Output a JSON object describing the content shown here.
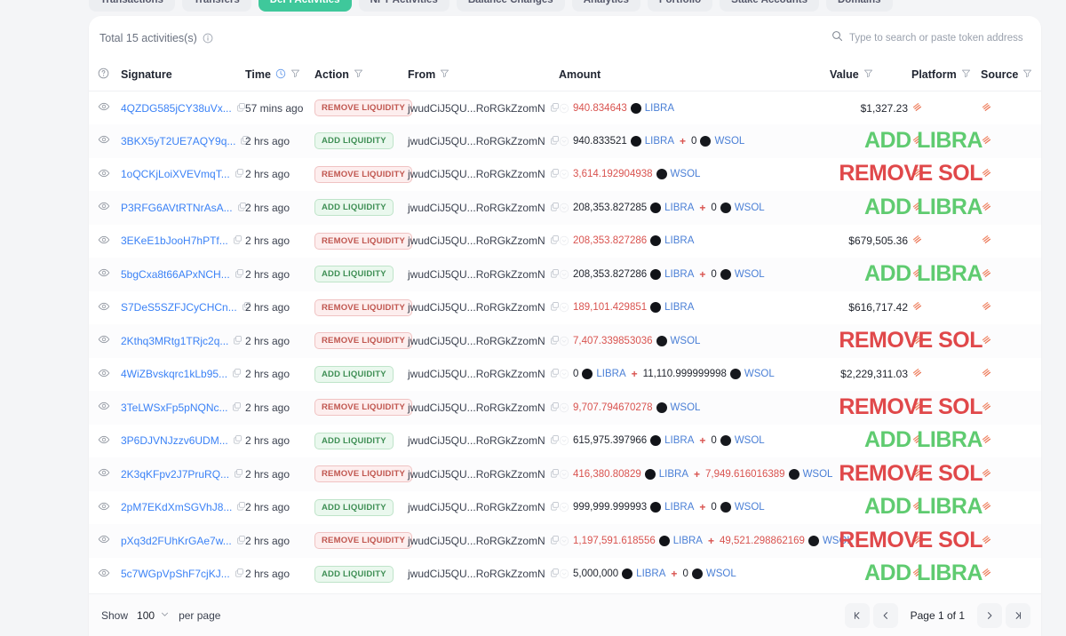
{
  "tabs": [
    {
      "label": "Transactions",
      "active": false
    },
    {
      "label": "Transfers",
      "active": false
    },
    {
      "label": "DeFi Activities",
      "active": true
    },
    {
      "label": "NFT Activities",
      "active": false
    },
    {
      "label": "Balance Changes",
      "active": false
    },
    {
      "label": "Analytics",
      "active": false
    },
    {
      "label": "Portfolio",
      "active": false
    },
    {
      "label": "Stake Accounts",
      "active": false
    },
    {
      "label": "Domains",
      "active": false
    }
  ],
  "header": {
    "total_text": "Total 15 activities(s)",
    "info_icon": "info-circle-icon",
    "search_placeholder": "Type to search or paste token address",
    "search_value": "",
    "search_icon": "search-icon"
  },
  "columns": {
    "eye": "",
    "signature": "Signature",
    "time": "Time",
    "action": "Action",
    "from": "From",
    "amount": "Amount",
    "value": "Value",
    "platform": "Platform",
    "source": "Source"
  },
  "colors": {
    "accent_green": "#3fc89b",
    "add_text": "#5fcb70",
    "remove_text": "#e0484a",
    "link_blue": "#3b82f6",
    "amount_red": "#d9534f",
    "token_blue": "#4a7fd6"
  },
  "rows": [
    {
      "signature": "4QZDG585jCY38uVx...",
      "time": "57 mins ago",
      "action": "REMOVE LIQUIDITY",
      "action_type": "remove",
      "from": "jwudCiJ5QU...RoRGkZzomN",
      "amount": [
        {
          "num": "940.834643",
          "num_color": "red",
          "token": "LIBRA"
        }
      ],
      "value": "$1,327.23",
      "overlay": "",
      "overlay_type": ""
    },
    {
      "signature": "3BKX5yT2UE7AQY9q...",
      "time": "2 hrs ago",
      "action": "ADD LIQUIDITY",
      "action_type": "add",
      "from": "jwudCiJ5QU...RoRGkZzomN",
      "amount": [
        {
          "num": "940.833521",
          "num_color": "black",
          "token": "LIBRA"
        },
        {
          "num": "0",
          "num_color": "black",
          "token": "WSOL"
        }
      ],
      "value": "",
      "overlay": "ADD LIBRA",
      "overlay_type": "green"
    },
    {
      "signature": "1oQCKjLoiXVEVmqT...",
      "time": "2 hrs ago",
      "action": "REMOVE LIQUIDITY",
      "action_type": "remove",
      "from": "jwudCiJ5QU...RoRGkZzomN",
      "amount": [
        {
          "num": "3,614.192904938",
          "num_color": "red",
          "token": "WSOL"
        }
      ],
      "value": "",
      "overlay": "REMOVE SOL",
      "overlay_type": "red"
    },
    {
      "signature": "P3RFG6AVtRTNrAsA...",
      "time": "2 hrs ago",
      "action": "ADD LIQUIDITY",
      "action_type": "add",
      "from": "jwudCiJ5QU...RoRGkZzomN",
      "amount": [
        {
          "num": "208,353.827285",
          "num_color": "black",
          "token": "LIBRA"
        },
        {
          "num": "0",
          "num_color": "black",
          "token": "WSOL"
        }
      ],
      "value": "",
      "overlay": "ADD LIBRA",
      "overlay_type": "green"
    },
    {
      "signature": "3EKeE1bJooH7hPTf...",
      "time": "2 hrs ago",
      "action": "REMOVE LIQUIDITY",
      "action_type": "remove",
      "from": "jwudCiJ5QU...RoRGkZzomN",
      "amount": [
        {
          "num": "208,353.827286",
          "num_color": "red",
          "token": "LIBRA"
        }
      ],
      "value": "$679,505.36",
      "overlay": "",
      "overlay_type": ""
    },
    {
      "signature": "5bgCxa8t66APxNCH...",
      "time": "2 hrs ago",
      "action": "ADD LIQUIDITY",
      "action_type": "add",
      "from": "jwudCiJ5QU...RoRGkZzomN",
      "amount": [
        {
          "num": "208,353.827286",
          "num_color": "black",
          "token": "LIBRA"
        },
        {
          "num": "0",
          "num_color": "black",
          "token": "WSOL"
        }
      ],
      "value": "",
      "overlay": "ADD LIBRA",
      "overlay_type": "green"
    },
    {
      "signature": "S7DeS5SZFJCyCHCn...",
      "time": "2 hrs ago",
      "action": "REMOVE LIQUIDITY",
      "action_type": "remove",
      "from": "jwudCiJ5QU...RoRGkZzomN",
      "amount": [
        {
          "num": "189,101.429851",
          "num_color": "red",
          "token": "LIBRA"
        }
      ],
      "value": "$616,717.42",
      "overlay": "",
      "overlay_type": ""
    },
    {
      "signature": "2Kthq3MRtg1TRjc2q...",
      "time": "2 hrs ago",
      "action": "REMOVE LIQUIDITY",
      "action_type": "remove",
      "from": "jwudCiJ5QU...RoRGkZzomN",
      "amount": [
        {
          "num": "7,407.339853036",
          "num_color": "red",
          "token": "WSOL"
        }
      ],
      "value": "",
      "overlay": "REMOVE SOL",
      "overlay_type": "red"
    },
    {
      "signature": "4WiZBvskqrc1kLb95...",
      "time": "2 hrs ago",
      "action": "ADD LIQUIDITY",
      "action_type": "add",
      "from": "jwudCiJ5QU...RoRGkZzomN",
      "amount": [
        {
          "num": "0",
          "num_color": "black",
          "token": "LIBRA"
        },
        {
          "num": "11,110.999999998",
          "num_color": "black",
          "token": "WSOL"
        }
      ],
      "value": "$2,229,311.03",
      "overlay": "",
      "overlay_type": ""
    },
    {
      "signature": "3TeLWSxFp5pNQNc...",
      "time": "2 hrs ago",
      "action": "REMOVE LIQUIDITY",
      "action_type": "remove",
      "from": "jwudCiJ5QU...RoRGkZzomN",
      "amount": [
        {
          "num": "9,707.794670278",
          "num_color": "red",
          "token": "WSOL"
        }
      ],
      "value": "",
      "overlay": "REMOVE SOL",
      "overlay_type": "red"
    },
    {
      "signature": "3P6DJVNJzzv6UDM...",
      "time": "2 hrs ago",
      "action": "ADD LIQUIDITY",
      "action_type": "add",
      "from": "jwudCiJ5QU...RoRGkZzomN",
      "amount": [
        {
          "num": "615,975.397966",
          "num_color": "black",
          "token": "LIBRA"
        },
        {
          "num": "0",
          "num_color": "black",
          "token": "WSOL"
        }
      ],
      "value": "",
      "overlay": "ADD LIBRA",
      "overlay_type": "green"
    },
    {
      "signature": "2K3qKFpv2J7PruRQ...",
      "time": "2 hrs ago",
      "action": "REMOVE LIQUIDITY",
      "action_type": "remove",
      "from": "jwudCiJ5QU...RoRGkZzomN",
      "amount": [
        {
          "num": "416,380.80829",
          "num_color": "red",
          "token": "LIBRA"
        },
        {
          "num": "7,949.616016389",
          "num_color": "red",
          "token": "WSOL"
        }
      ],
      "value": "",
      "overlay": "REMOVE SOL",
      "overlay_type": "red"
    },
    {
      "signature": "2pM7EKdXmSGVhJ8...",
      "time": "2 hrs ago",
      "action": "ADD LIQUIDITY",
      "action_type": "add",
      "from": "jwudCiJ5QU...RoRGkZzomN",
      "amount": [
        {
          "num": "999,999.999993",
          "num_color": "black",
          "token": "LIBRA"
        },
        {
          "num": "0",
          "num_color": "black",
          "token": "WSOL"
        }
      ],
      "value": "",
      "overlay": "ADD LIBRA",
      "overlay_type": "green"
    },
    {
      "signature": "pXq3d2FUhKrGAe7w...",
      "time": "2 hrs ago",
      "action": "REMOVE LIQUIDITY",
      "action_type": "remove",
      "from": "jwudCiJ5QU...RoRGkZzomN",
      "amount": [
        {
          "num": "1,197,591.618556",
          "num_color": "red",
          "token": "LIBRA"
        },
        {
          "num": "49,521.298862169",
          "num_color": "red",
          "token": "WSOL"
        }
      ],
      "value": "",
      "overlay": "REMOVE SOL",
      "overlay_type": "red"
    },
    {
      "signature": "5c7WGpVpShF7cjKJ...",
      "time": "2 hrs ago",
      "action": "ADD LIQUIDITY",
      "action_type": "add",
      "from": "jwudCiJ5QU...RoRGkZzomN",
      "amount": [
        {
          "num": "5,000,000",
          "num_color": "black",
          "token": "LIBRA"
        },
        {
          "num": "0",
          "num_color": "black",
          "token": "WSOL"
        }
      ],
      "value": "",
      "overlay": "ADD LIBRA",
      "overlay_type": "green"
    }
  ],
  "footer": {
    "show_label": "Show",
    "page_size": "100",
    "per_page_label": "per page",
    "first_icon": "first-page-icon",
    "prev_icon": "prev-page-icon",
    "page_label": "Page 1 of 1",
    "next_icon": "next-page-icon",
    "last_icon": "last-page-icon"
  }
}
